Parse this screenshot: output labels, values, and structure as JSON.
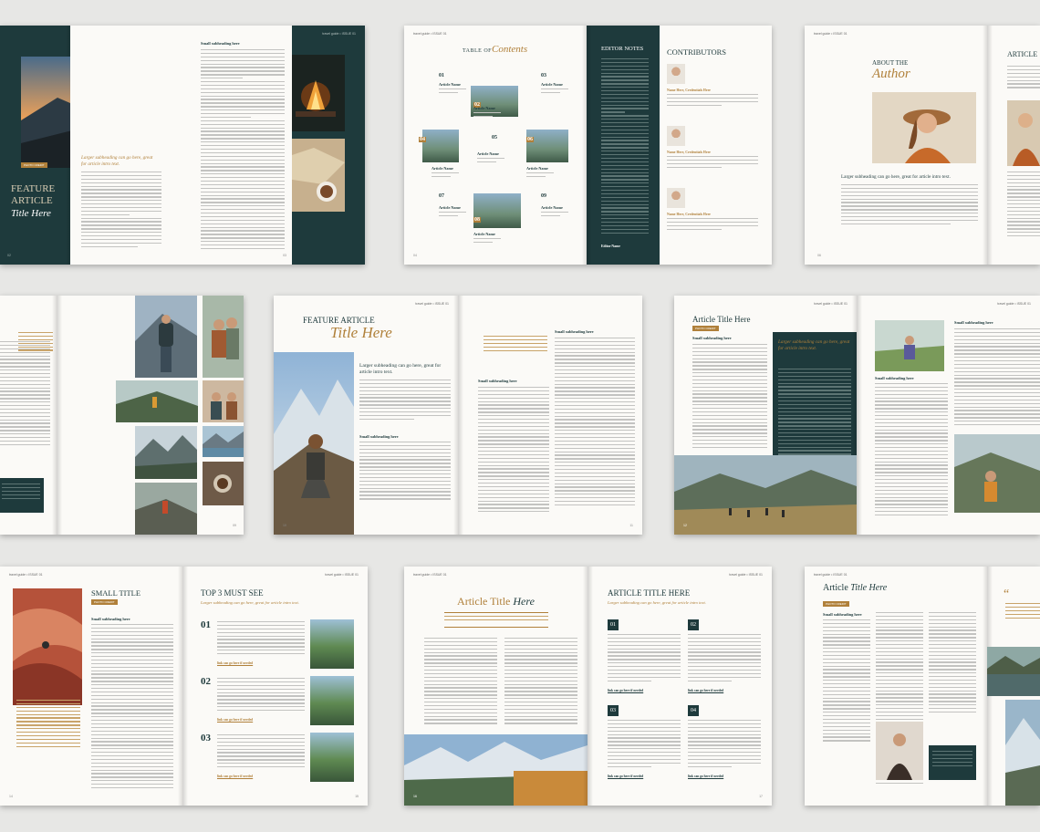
{
  "running_header": "travel guide • ISSUE 01",
  "feature": {
    "title_line1": "FEATURE",
    "title_line2": "ARTICLE",
    "title_italic": "Title Here",
    "subheading": "Larger subheading can go here, great for article intro text.",
    "small_subheading": "Small subheading here",
    "tag": "PHOTO CREDIT",
    "page_left": "02",
    "page_right": "03"
  },
  "contents": {
    "title_small": "TABLE OF",
    "title_italic": "Contents",
    "items": [
      {
        "num": "01",
        "name": "Article Name",
        "desc": "Article Name"
      },
      {
        "num": "02",
        "name": "Article Name",
        "desc": "Article Name"
      },
      {
        "num": "03",
        "name": "Article Name",
        "desc": "Article Name"
      },
      {
        "num": "04",
        "name": "Article Name",
        "desc": "Article Name"
      },
      {
        "num": "05",
        "name": "Article Name",
        "desc": "Article Name"
      },
      {
        "num": "06",
        "name": "Article Name",
        "desc": "Article Name"
      },
      {
        "num": "07",
        "name": "Article Name",
        "desc": "Article Name"
      },
      {
        "num": "08",
        "name": "Article Name",
        "desc": "Article Name"
      },
      {
        "num": "09",
        "name": "Article Name",
        "desc": "Article Name"
      }
    ],
    "editor_notes": "EDITOR NOTES",
    "editor_name": "Editor Name",
    "contributors": "CONTRIBUTORS",
    "contributor_names": [
      "Name Here, Credentials Here",
      "Name Here, Credentials Here",
      "Name Here, Credentials Here"
    ]
  },
  "author": {
    "title_small": "ABOUT THE",
    "title_italic": "Author",
    "subheading": "Larger subheading can go here, great for article intro text.",
    "right_title": "ARTICLE"
  },
  "quote_spread": {
    "quote_mark": "“"
  },
  "feature2": {
    "title_small": "FEATURE ARTICLE",
    "title_italic": "Title Here",
    "subheading": "Larger subheading can go here, great for article intro text.",
    "small_subheading": "Small subheading here"
  },
  "article_dark": {
    "title": "Article Title Here",
    "tag": "PHOTO CREDIT",
    "small_subheading": "Small subheading here",
    "subheading": "Larger subheading can go here, great for article intro text."
  },
  "small_title": {
    "title": "SMALL TITLE",
    "tag": "PHOTO CREDIT",
    "small_subheading": "Small subheading here"
  },
  "top3": {
    "title": "TOP 3 MUST SEE",
    "subheading": "Larger subheading can go here, great for article intro text.",
    "items": [
      "01",
      "02",
      "03"
    ],
    "link": "link can go here if needed"
  },
  "article_center": {
    "title_plain": "Article Title",
    "title_italic": "Here"
  },
  "article_caps": {
    "title": "ARTICLE TITLE HERE",
    "subheading": "Larger subheading can go here, great for article intro text.",
    "items": [
      "01",
      "02",
      "03",
      "04"
    ],
    "link": "link can go here if needed"
  },
  "article_last": {
    "title_plain": "Article",
    "title_italic": "Title Here",
    "tag": "PHOTO CREDIT",
    "small_subheading": "Small subheading here"
  },
  "colors": {
    "teal": "#1e3a3c",
    "gold": "#b0803a",
    "paper": "#fbfaf7"
  }
}
